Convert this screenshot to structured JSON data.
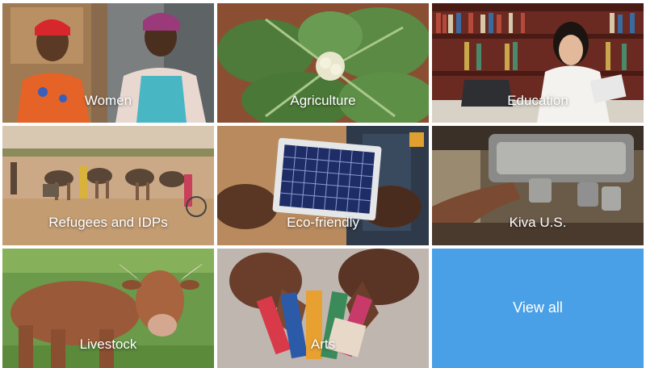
{
  "tiles": [
    {
      "label": "Women"
    },
    {
      "label": "Agriculture"
    },
    {
      "label": "Education"
    },
    {
      "label": "Refugees and IDPs"
    },
    {
      "label": "Eco-friendly"
    },
    {
      "label": "Kiva U.S."
    },
    {
      "label": "Livestock"
    },
    {
      "label": "Arts"
    },
    {
      "label": "View all"
    }
  ],
  "colors": {
    "view_all_bg": "#4aa0e6",
    "label_text": "#ffffff"
  }
}
